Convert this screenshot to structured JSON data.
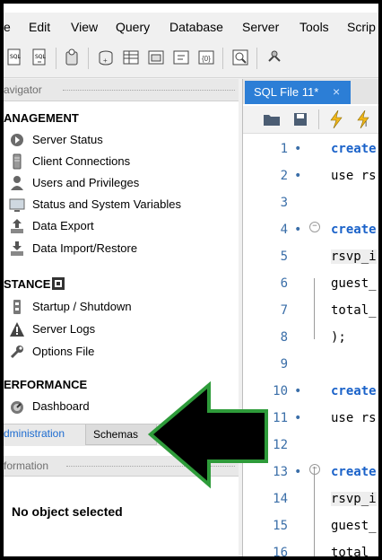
{
  "menu": [
    "e",
    "Edit",
    "View",
    "Query",
    "Database",
    "Server",
    "Tools",
    "Scrip"
  ],
  "navigator": {
    "header": "avigator",
    "sections": [
      {
        "title": "ANAGEMENT",
        "items": [
          {
            "label": "Server Status",
            "icon": "server-status-icon"
          },
          {
            "label": "Client Connections",
            "icon": "client-connections-icon"
          },
          {
            "label": "Users and Privileges",
            "icon": "users-icon"
          },
          {
            "label": "Status and System Variables",
            "icon": "variables-icon"
          },
          {
            "label": "Data Export",
            "icon": "export-icon"
          },
          {
            "label": "Data Import/Restore",
            "icon": "import-icon"
          }
        ]
      },
      {
        "title": "STANCE",
        "items": [
          {
            "label": "Startup / Shutdown",
            "icon": "startup-icon"
          },
          {
            "label": "Server Logs",
            "icon": "logs-icon"
          },
          {
            "label": "Options File",
            "icon": "wrench-icon"
          }
        ]
      },
      {
        "title": "ERFORMANCE",
        "items": [
          {
            "label": "Dashboard",
            "icon": "dashboard-icon"
          }
        ]
      }
    ],
    "tabs": {
      "administration": "dministration",
      "schemas": "Schemas"
    }
  },
  "information": {
    "header": "formation",
    "empty": "No object selected"
  },
  "editor": {
    "tab": "SQL File 11*",
    "close": "×",
    "lines": [
      {
        "n": "1",
        "mark": "•",
        "text": "create",
        "kw": true,
        "hl": false,
        "fold": false
      },
      {
        "n": "2",
        "mark": "•",
        "text": "use rs",
        "kw": false,
        "hl": false,
        "fold": false
      },
      {
        "n": "3",
        "mark": "",
        "text": "",
        "kw": false,
        "hl": false,
        "fold": false
      },
      {
        "n": "4",
        "mark": "•",
        "text": "create",
        "kw": true,
        "hl": false,
        "fold": true
      },
      {
        "n": "5",
        "mark": "",
        "text": "rsvp_i",
        "kw": false,
        "hl": true,
        "fold": false
      },
      {
        "n": "6",
        "mark": "",
        "text": "guest_",
        "kw": false,
        "hl": false,
        "fold": false
      },
      {
        "n": "7",
        "mark": "",
        "text": "total_",
        "kw": false,
        "hl": false,
        "fold": false
      },
      {
        "n": "8",
        "mark": "",
        "text": ");",
        "kw": false,
        "hl": false,
        "fold": false
      },
      {
        "n": "9",
        "mark": "",
        "text": "",
        "kw": false,
        "hl": false,
        "fold": false
      },
      {
        "n": "10",
        "mark": "•",
        "text": "create",
        "kw": true,
        "hl": false,
        "fold": false
      },
      {
        "n": "11",
        "mark": "•",
        "text": "use rs",
        "kw": false,
        "hl": false,
        "fold": false
      },
      {
        "n": "12",
        "mark": "",
        "text": "",
        "kw": false,
        "hl": false,
        "fold": false
      },
      {
        "n": "13",
        "mark": "•",
        "text": "create",
        "kw": true,
        "hl": false,
        "fold": true
      },
      {
        "n": "14",
        "mark": "",
        "text": "rsvp_i",
        "kw": false,
        "hl": true,
        "fold": false
      },
      {
        "n": "15",
        "mark": "",
        "text": "guest_",
        "kw": false,
        "hl": false,
        "fold": false
      },
      {
        "n": "16",
        "mark": "",
        "text": "total_",
        "kw": false,
        "hl": false,
        "fold": false
      }
    ]
  },
  "colors": {
    "accent": "#2c7ed6",
    "keyword": "#1a62c9",
    "arrow_fill": "#000000",
    "arrow_border": "#2e9b3a"
  }
}
